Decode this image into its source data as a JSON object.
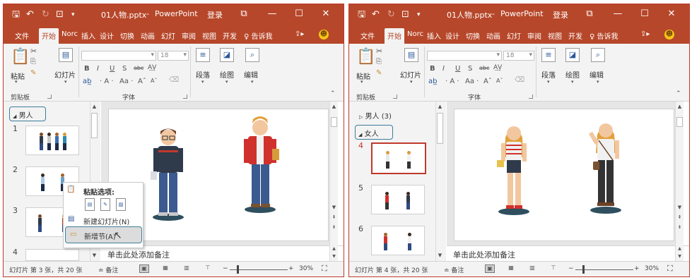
{
  "left": {
    "title_bar": {
      "file_name": "01人物.pptx",
      "separator": "-",
      "app_name": "PowerPoint",
      "login_label": "登录",
      "restore_label": "⧉",
      "min_label": "—",
      "max_label": "☐",
      "close_label": "✕"
    },
    "tabs": [
      "文件",
      "开始",
      "Norc",
      "插入",
      "设计",
      "切换",
      "动画",
      "幻灯",
      "审阅",
      "视图",
      "开发",
      "♀ 告诉我"
    ],
    "ribbon": {
      "paste": "粘贴",
      "slides": "幻灯片",
      "paragraph": "段落",
      "drawing": "绘图",
      "editing": "编辑",
      "font_size": "18",
      "clipboard_group": "剪贴板",
      "font_group": "字体"
    },
    "thumbs": {
      "section_label": "男人",
      "numbers": [
        "1",
        "2",
        "3",
        "4"
      ]
    },
    "context_menu": {
      "paste_options": "粘贴选项:",
      "new_slide": "新建幻灯片(N)",
      "new_section": "新增节(A)"
    },
    "notes_placeholder": "单击此处添加备注",
    "status": {
      "slide_info": "幻灯片 第 3 张，共 20 张",
      "notes_label": "≐ 备注",
      "zoom": "30%"
    }
  },
  "right": {
    "title_bar": {
      "file_name": "01人物.pptx",
      "separator": "-",
      "app_name": "PowerPoint",
      "login_label": "登录",
      "restore_label": "⧉",
      "min_label": "—",
      "max_label": "☐",
      "close_label": "✕"
    },
    "tabs": [
      "文件",
      "开始",
      "Norc",
      "插入",
      "设计",
      "切换",
      "动画",
      "幻灯",
      "审阅",
      "视图",
      "开发",
      "♀ 告诉我"
    ],
    "ribbon": {
      "paste": "粘贴",
      "slides": "幻灯片",
      "paragraph": "段落",
      "drawing": "绘图",
      "editing": "编辑",
      "font_size": "18",
      "clipboard_group": "剪贴板",
      "font_group": "字体"
    },
    "thumbs": {
      "section1_label": "男人 (3)",
      "section2_label": "女人",
      "numbers": [
        "4",
        "5",
        "6"
      ]
    },
    "notes_placeholder": "单击此处添加备注",
    "status": {
      "slide_info": "幻灯片 第 4 张，共 20 张",
      "notes_label": "≐ 备注",
      "zoom": "30%"
    }
  },
  "colors": {
    "brand": "#b7472a",
    "selected_border": "#c0392b",
    "section_outline": "#3d7d9b"
  }
}
